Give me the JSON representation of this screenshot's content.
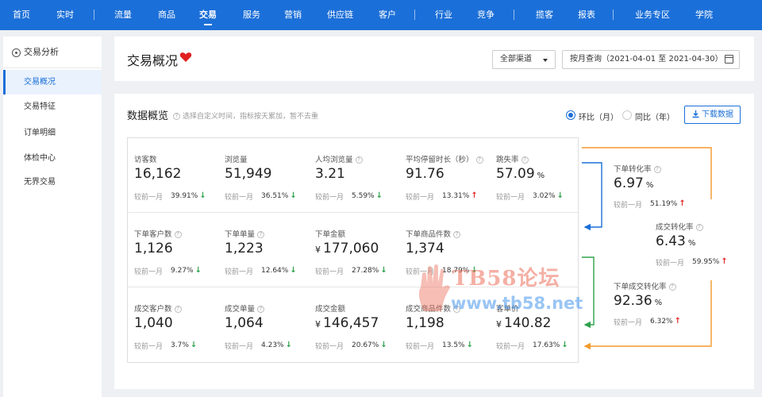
{
  "topnav": {
    "items": [
      "首页",
      "实时",
      "流量",
      "商品",
      "交易",
      "服务",
      "营销",
      "供应链",
      "客户",
      "行业",
      "竞争",
      "揽客",
      "报表",
      "业务专区",
      "学院"
    ],
    "active": "交易"
  },
  "sidebar": {
    "header": "交易分析",
    "items": [
      "交易概况",
      "交易特征",
      "订单明细",
      "体检中心",
      "无界交易"
    ],
    "active": "交易概况"
  },
  "header": {
    "title": "交易概况",
    "channel_select": "全部渠道",
    "date_select": "按月查询（2021-04-01 至 2021-04-30）"
  },
  "overview": {
    "title": "数据概览",
    "hint": "选择自定义时间，指标按天累加，暂不去重",
    "compare_mom": "环比（月）",
    "compare_yoy": "同比（年）",
    "download": "下载数据",
    "compare_label": "较前一月",
    "rows": [
      [
        {
          "label": "访客数",
          "value": "16,162",
          "unit": "",
          "prefix": "",
          "help": false,
          "change": "39.91%",
          "trend": "down"
        },
        {
          "label": "浏览量",
          "value": "51,949",
          "unit": "",
          "prefix": "",
          "help": false,
          "change": "36.51%",
          "trend": "down"
        },
        {
          "label": "人均浏览量",
          "value": "3.21",
          "unit": "",
          "prefix": "",
          "help": true,
          "change": "5.59%",
          "trend": "down"
        },
        {
          "label": "平均停留时长（秒）",
          "value": "91.76",
          "unit": "",
          "prefix": "",
          "help": true,
          "change": "13.31%",
          "trend": "up"
        },
        {
          "label": "跳失率",
          "value": "57.09",
          "unit": "%",
          "prefix": "",
          "help": true,
          "change": "3.02%",
          "trend": "down"
        }
      ],
      [
        {
          "label": "下单客户数",
          "value": "1,126",
          "unit": "",
          "prefix": "",
          "help": true,
          "change": "9.27%",
          "trend": "down"
        },
        {
          "label": "下单单量",
          "value": "1,223",
          "unit": "",
          "prefix": "",
          "help": true,
          "change": "12.64%",
          "trend": "down"
        },
        {
          "label": "下单金额",
          "value": "177,060",
          "unit": "",
          "prefix": "¥",
          "help": false,
          "change": "27.28%",
          "trend": "down"
        },
        {
          "label": "下单商品件数",
          "value": "1,374",
          "unit": "",
          "prefix": "",
          "help": true,
          "change": "18.79%",
          "trend": "down"
        }
      ],
      [
        {
          "label": "成交客户数",
          "value": "1,040",
          "unit": "",
          "prefix": "",
          "help": true,
          "change": "3.7%",
          "trend": "down"
        },
        {
          "label": "成交单量",
          "value": "1,064",
          "unit": "",
          "prefix": "",
          "help": true,
          "change": "4.23%",
          "trend": "down"
        },
        {
          "label": "成交金额",
          "value": "146,457",
          "unit": "",
          "prefix": "¥",
          "help": false,
          "change": "20.67%",
          "trend": "down"
        },
        {
          "label": "成交商品件数",
          "value": "1,198",
          "unit": "",
          "prefix": "",
          "help": true,
          "change": "13.5%",
          "trend": "down"
        },
        {
          "label": "客单价",
          "value": "140.82",
          "unit": "",
          "prefix": "¥",
          "help": false,
          "change": "17.63%",
          "trend": "down"
        }
      ]
    ],
    "funnel": [
      {
        "label": "下单转化率",
        "value": "6.97",
        "unit": "%",
        "change": "51.19%",
        "trend": "up"
      },
      {
        "label": "成交转化率",
        "value": "6.43",
        "unit": "%",
        "change": "59.95%",
        "trend": "up"
      },
      {
        "label": "下单成交转化率",
        "value": "92.36",
        "unit": "%",
        "change": "6.32%",
        "trend": "up"
      }
    ],
    "colors": {
      "blue": "#1b6fd8",
      "green": "#2ea24b",
      "orange": "#f39a2b",
      "red": "#e02e2e"
    }
  },
  "watermark": {
    "line1": "TB58论坛",
    "line2": "www.tb58.net"
  }
}
